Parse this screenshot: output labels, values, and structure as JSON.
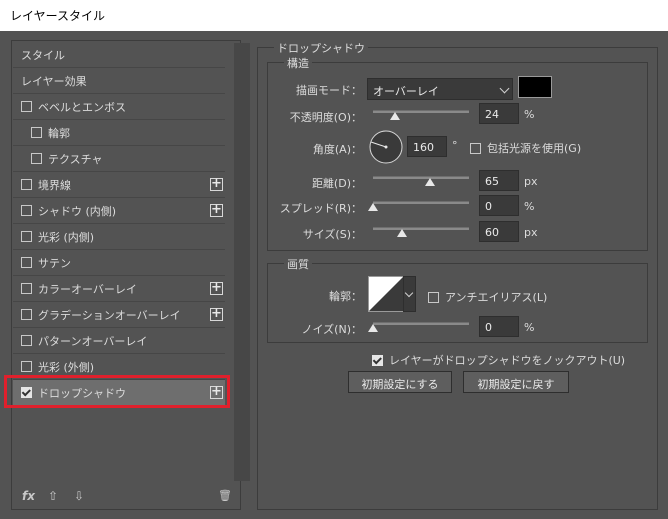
{
  "window": {
    "title": "レイヤースタイル"
  },
  "sidebar": {
    "items": [
      {
        "label": "スタイル",
        "checkbox": false
      },
      {
        "label": "レイヤー効果",
        "checkbox": false
      },
      {
        "label": "ベベルとエンボス",
        "checkbox": true,
        "checked": false
      },
      {
        "label": "輪郭",
        "checkbox": true,
        "checked": false,
        "indent": true
      },
      {
        "label": "テクスチャ",
        "checkbox": true,
        "checked": false,
        "indent": true
      },
      {
        "label": "境界線",
        "checkbox": true,
        "checked": false,
        "plus": true
      },
      {
        "label": "シャドウ (内側)",
        "checkbox": true,
        "checked": false,
        "plus": true
      },
      {
        "label": "光彩 (内側)",
        "checkbox": true,
        "checked": false
      },
      {
        "label": "サテン",
        "checkbox": true,
        "checked": false
      },
      {
        "label": "カラーオーバーレイ",
        "checkbox": true,
        "checked": false,
        "plus": true
      },
      {
        "label": "グラデーションオーバーレイ",
        "checkbox": true,
        "checked": false,
        "plus": true
      },
      {
        "label": "パターンオーバーレイ",
        "checkbox": true,
        "checked": false
      },
      {
        "label": "光彩 (外側)",
        "checkbox": true,
        "checked": false
      },
      {
        "label": "ドロップシャドウ",
        "checkbox": true,
        "checked": true,
        "plus": true,
        "selected": true
      }
    ],
    "tools": {
      "fx": "fx",
      "up": "⇧",
      "down": "⇩",
      "trash": "🗑"
    }
  },
  "drop_shadow": {
    "section_title": "ドロップシャドウ",
    "structure": {
      "title": "構造",
      "blend_mode_label": "描画モード：",
      "blend_mode_value": "オーバーレイ",
      "shadow_color": "#000000",
      "opacity_label": "不透明度(O)：",
      "opacity_value": "24",
      "opacity_unit": "%",
      "angle_label": "角度(A)：",
      "angle_value": "160",
      "angle_unit": "°",
      "global_light_label": "包括光源を使用(G)",
      "global_light_checked": false,
      "distance_label": "距離(D)：",
      "distance_value": "65",
      "distance_unit": "px",
      "spread_label": "スプレッド(R)：",
      "spread_value": "0",
      "spread_unit": "%",
      "size_label": "サイズ(S)：",
      "size_value": "60",
      "size_unit": "px"
    },
    "quality": {
      "title": "画質",
      "contour_label": "輪郭：",
      "antialias_label": "アンチエイリアス(L)",
      "antialias_checked": false,
      "noise_label": "ノイズ(N)：",
      "noise_value": "0",
      "noise_unit": "%"
    },
    "knockout_label": "レイヤーがドロップシャドウをノックアウト(U)",
    "knockout_checked": true,
    "make_default_label": "初期設定にする",
    "reset_default_label": "初期設定に戻す"
  }
}
